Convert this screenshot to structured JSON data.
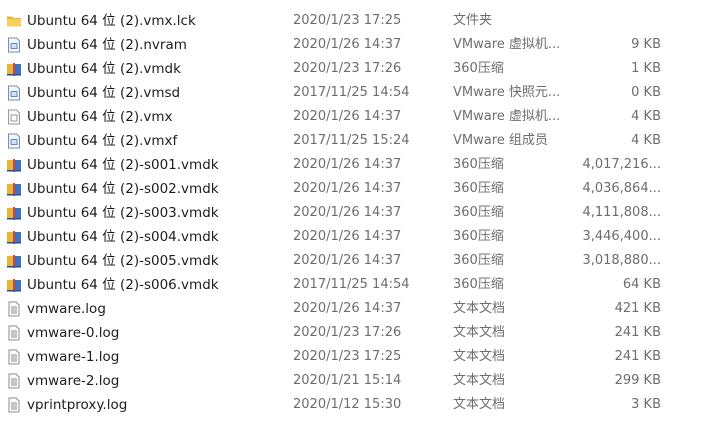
{
  "files": [
    {
      "name": "Ubuntu 64 位 (2).vmx.lck",
      "date": "2020/1/23 17:25",
      "type": "文件夹",
      "size": "",
      "icon": "folder-icon"
    },
    {
      "name": "Ubuntu 64 位 (2).nvram",
      "date": "2020/1/26 14:37",
      "type": "VMware 虚拟机...",
      "size": "9 KB",
      "icon": "vmware-file-icon"
    },
    {
      "name": "Ubuntu 64 位 (2).vmdk",
      "date": "2020/1/23 17:26",
      "type": "360压缩",
      "size": "1 KB",
      "icon": "archive-icon"
    },
    {
      "name": "Ubuntu 64 位 (2).vmsd",
      "date": "2017/11/25 14:54",
      "type": "VMware 快照元...",
      "size": "0 KB",
      "icon": "vmware-file-icon"
    },
    {
      "name": "Ubuntu 64 位 (2).vmx",
      "date": "2020/1/26 14:37",
      "type": "VMware 虚拟机...",
      "size": "4 KB",
      "icon": "vmware-config-icon"
    },
    {
      "name": "Ubuntu 64 位 (2).vmxf",
      "date": "2017/11/25 15:24",
      "type": "VMware 组成员",
      "size": "4 KB",
      "icon": "vmware-file-icon"
    },
    {
      "name": "Ubuntu 64 位 (2)-s001.vmdk",
      "date": "2020/1/26 14:37",
      "type": "360压缩",
      "size": "4,017,216...",
      "icon": "archive-icon"
    },
    {
      "name": "Ubuntu 64 位 (2)-s002.vmdk",
      "date": "2020/1/26 14:37",
      "type": "360压缩",
      "size": "4,036,864...",
      "icon": "archive-icon"
    },
    {
      "name": "Ubuntu 64 位 (2)-s003.vmdk",
      "date": "2020/1/26 14:37",
      "type": "360压缩",
      "size": "4,111,808...",
      "icon": "archive-icon"
    },
    {
      "name": "Ubuntu 64 位 (2)-s004.vmdk",
      "date": "2020/1/26 14:37",
      "type": "360压缩",
      "size": "3,446,400...",
      "icon": "archive-icon"
    },
    {
      "name": "Ubuntu 64 位 (2)-s005.vmdk",
      "date": "2020/1/26 14:37",
      "type": "360压缩",
      "size": "3,018,880...",
      "icon": "archive-icon"
    },
    {
      "name": "Ubuntu 64 位 (2)-s006.vmdk",
      "date": "2017/11/25 14:54",
      "type": "360压缩",
      "size": "64 KB",
      "icon": "archive-icon"
    },
    {
      "name": "vmware.log",
      "date": "2020/1/26 14:37",
      "type": "文本文档",
      "size": "421 KB",
      "icon": "text-document-icon"
    },
    {
      "name": "vmware-0.log",
      "date": "2020/1/23 17:26",
      "type": "文本文档",
      "size": "241 KB",
      "icon": "text-document-icon"
    },
    {
      "name": "vmware-1.log",
      "date": "2020/1/23 17:25",
      "type": "文本文档",
      "size": "241 KB",
      "icon": "text-document-icon"
    },
    {
      "name": "vmware-2.log",
      "date": "2020/1/21 15:14",
      "type": "文本文档",
      "size": "299 KB",
      "icon": "text-document-icon"
    },
    {
      "name": "vprintproxy.log",
      "date": "2020/1/12 15:30",
      "type": "文本文档",
      "size": "3 KB",
      "icon": "text-document-icon"
    }
  ]
}
